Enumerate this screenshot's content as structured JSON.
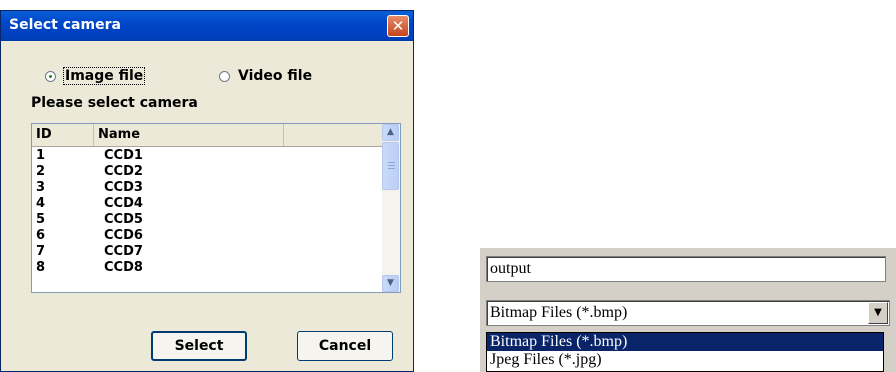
{
  "dialog": {
    "title": "Select camera",
    "close_glyph": "✕",
    "radios": [
      {
        "label": "Image file",
        "checked": true
      },
      {
        "label": "Video file",
        "checked": false
      }
    ],
    "prompt": "Please select camera",
    "list": {
      "columns": [
        "ID",
        "Name",
        ""
      ],
      "rows": [
        {
          "id": "1",
          "name": "CCD1"
        },
        {
          "id": "2",
          "name": "CCD2"
        },
        {
          "id": "3",
          "name": "CCD3"
        },
        {
          "id": "4",
          "name": "CCD4"
        },
        {
          "id": "5",
          "name": "CCD5"
        },
        {
          "id": "6",
          "name": "CCD6"
        },
        {
          "id": "7",
          "name": "CCD7"
        },
        {
          "id": "8",
          "name": "CCD8"
        }
      ]
    },
    "buttons": {
      "select": "Select",
      "cancel": "Cancel"
    }
  },
  "file_panel": {
    "filename": "output",
    "file_type": "Bitmap Files (*.bmp)",
    "options": [
      "Bitmap Files (*.bmp)",
      "Jpeg Files (*.jpg)"
    ],
    "selected_option": 0
  },
  "colors": {
    "titlebar": "#0046c8",
    "dialog_face": "#ece9d8",
    "panel_face": "#d4d0c8",
    "selection": "#0a246a"
  }
}
